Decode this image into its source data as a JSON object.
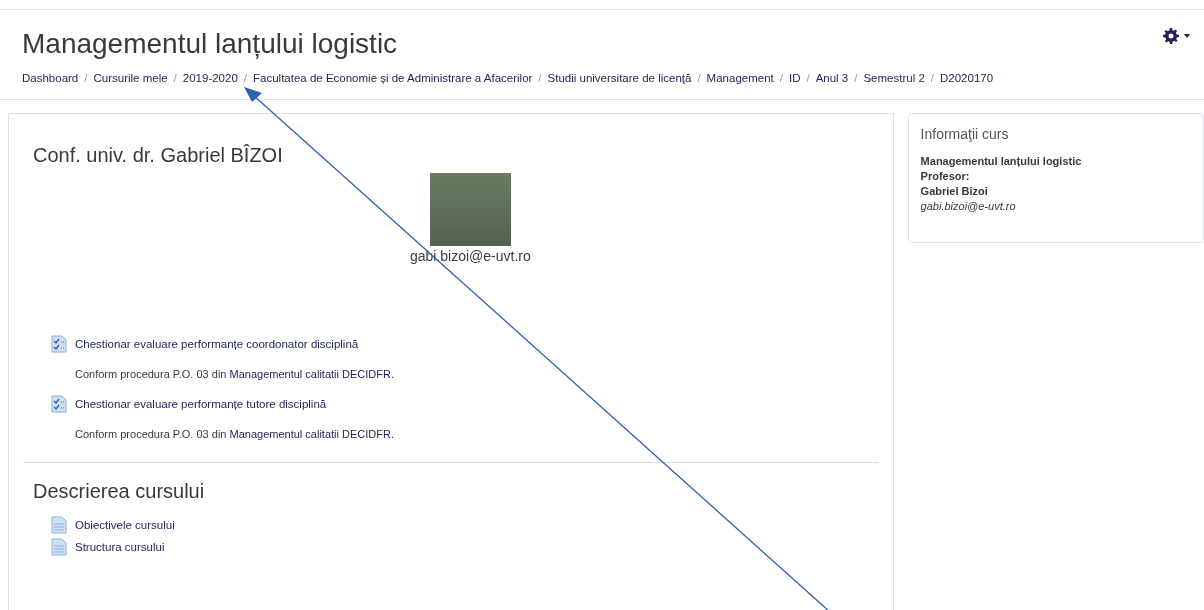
{
  "page_title": "Managementul lanțului logistic",
  "breadcrumb": [
    "Dashboard",
    "Cursurile mele",
    "2019-2020",
    "Facultatea de Economie și de Administrare a Afacerilor",
    "Studii universitare de licenţă",
    "Management",
    "ID",
    "Anul 3",
    "Semestrul 2",
    "D2020170"
  ],
  "breadcrumb_separator": "/",
  "teacher": {
    "name": "Conf. univ. dr. Gabriel BÎZOI",
    "email": "gabi.bizoi@e-uvt.ro"
  },
  "activities": [
    {
      "kind": "quiz",
      "title": "Chestionar evaluare performanțe coordonator disciplină",
      "desc_prefix": "Conform procedura P.O. 03 din ",
      "desc_link": "Managementul calitatii DECIDFR",
      "desc_suffix": "."
    },
    {
      "kind": "quiz",
      "title": "Chestionar evaluare performanțe tutore disciplină",
      "desc_prefix": "Conform procedura P.O. 03 din ",
      "desc_link": "Managementul calitatii DECIDFR",
      "desc_suffix": "."
    }
  ],
  "section": {
    "title": "Descrierea cursului",
    "items": [
      {
        "kind": "page",
        "title": "Obiectivele cursului"
      },
      {
        "kind": "page",
        "title": "Structura cursului"
      }
    ]
  },
  "info_block": {
    "title": "Informaţii curs",
    "course": "Managementul lanțului logistic",
    "label": "Profesor:",
    "teacher": "Gabriel Bîzoi",
    "email": "gabi.bizoi@e-uvt.ro"
  }
}
